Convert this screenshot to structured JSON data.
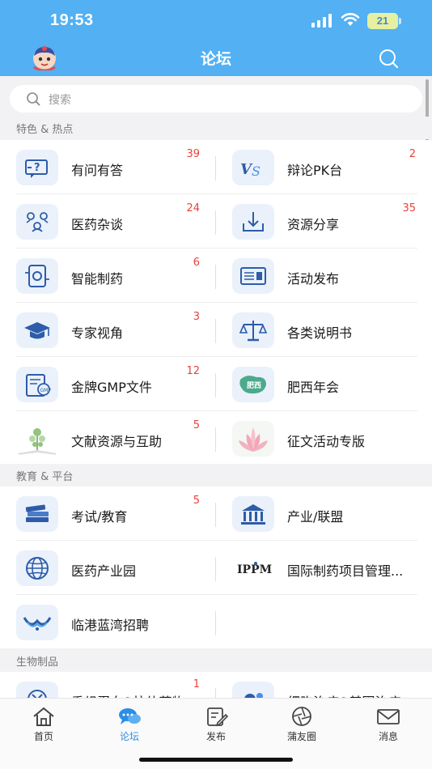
{
  "status_bar": {
    "time": "19:53",
    "battery": "21"
  },
  "navbar": {
    "title": "论坛"
  },
  "search": {
    "placeholder": "搜索"
  },
  "sections": {
    "featured": {
      "header": "特色 & 热点",
      "items": [
        {
          "label": "有问有答",
          "count": "39",
          "icon": "question-card-icon"
        },
        {
          "label": "辩论PK台",
          "count": "2",
          "icon": "versus-icon"
        },
        {
          "label": "医药杂谈",
          "count": "24",
          "icon": "people-chat-icon"
        },
        {
          "label": "资源分享",
          "count": "35",
          "icon": "download-tray-icon"
        },
        {
          "label": "智能制药",
          "count": "6",
          "icon": "smart-device-icon"
        },
        {
          "label": "活动发布",
          "count": "",
          "icon": "bulletin-icon"
        },
        {
          "label": "专家视角",
          "count": "3",
          "icon": "graduation-cap-icon"
        },
        {
          "label": "各类说明书",
          "count": "",
          "icon": "scale-icon"
        },
        {
          "label": "金牌GMP文件",
          "count": "12",
          "icon": "gmp-document-icon"
        },
        {
          "label": "肥西年会",
          "count": "",
          "icon": "feixi-map-icon"
        },
        {
          "label": "文献资源与互助",
          "count": "5",
          "icon": "book-plant-icon"
        },
        {
          "label": "征文活动专版",
          "count": "",
          "icon": "lotus-icon"
        }
      ]
    },
    "education": {
      "header": "教育 & 平台",
      "items": [
        {
          "label": "考试/教育",
          "count": "5",
          "icon": "books-icon"
        },
        {
          "label": "产业/联盟",
          "count": "",
          "icon": "alliance-icon"
        },
        {
          "label": "医药产业园",
          "count": "",
          "icon": "globe-icon"
        },
        {
          "label": "国际制药项目管理...",
          "count": "",
          "icon": "ippm-logo-icon"
        },
        {
          "label": "临港蓝湾招聘",
          "count": "",
          "icon": "bluebay-logo-icon"
        }
      ]
    },
    "bio": {
      "header": "生物制品",
      "items": [
        {
          "label": "重组蛋白&抗体药物",
          "count": "1",
          "icon": "protein-icon"
        },
        {
          "label": "细胞治疗&基因治疗",
          "count": "",
          "icon": "cell-therapy-icon"
        }
      ]
    }
  },
  "tabbar": {
    "home": "首页",
    "forum": "论坛",
    "publish": "发布",
    "friends": "蒲友圈",
    "messages": "消息"
  },
  "colors": {
    "primary": "#52b0f3",
    "badge": "#e8413a",
    "active_tab": "#2a8ee8"
  }
}
